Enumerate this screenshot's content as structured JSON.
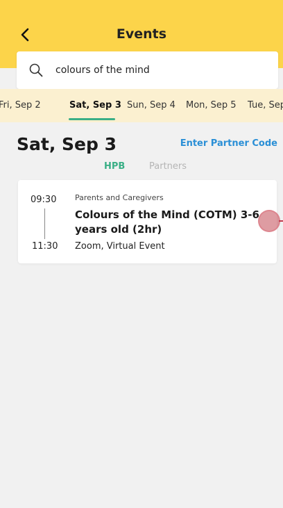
{
  "header": {
    "title": "Events",
    "background_color": "#fcd44a",
    "back_icon": "chevron-left-icon"
  },
  "search": {
    "value": "colours of the mind",
    "icon": "search-icon"
  },
  "date_tabs": [
    {
      "label": "Fri, Sep 2",
      "active": false
    },
    {
      "label": "Sat, Sep 3",
      "active": true
    },
    {
      "label": "Sun, Sep 4",
      "active": false
    },
    {
      "label": "Mon, Sep 5",
      "active": false
    },
    {
      "label": "Tue, Sep",
      "active": false
    }
  ],
  "day": {
    "heading": "Sat, Sep 3",
    "partner_code_link": "Enter Partner Code"
  },
  "segments": {
    "hpb": "HPB",
    "partners": "Partners",
    "active": "HPB",
    "accent_color": "#3aaf86"
  },
  "events": [
    {
      "start_time": "09:30",
      "end_time": "11:30",
      "category": "Parents and Caregivers",
      "title": "Colours of the Mind (COTM) 3-6 years old (2hr)",
      "location": "Zoom, Virtual Event"
    }
  ],
  "colors": {
    "link": "#2a8fd6",
    "background": "#f1f1f1",
    "date_strip": "#fbf0d0"
  }
}
